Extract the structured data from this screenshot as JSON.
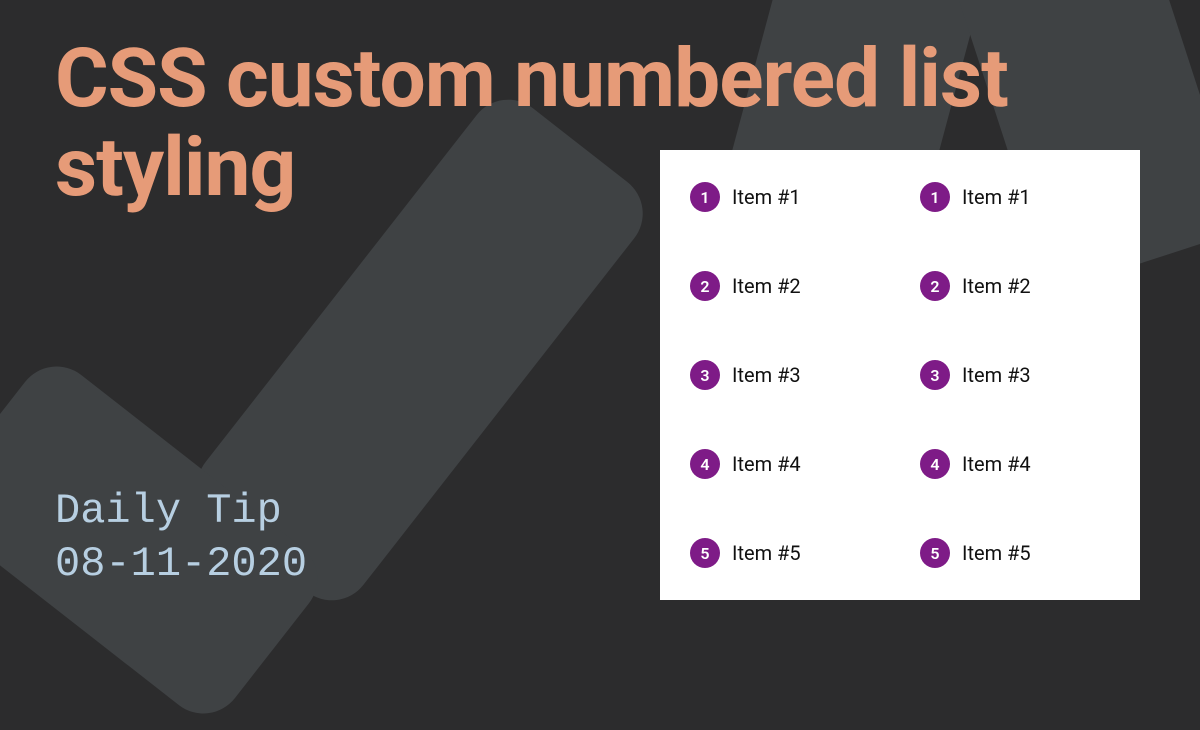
{
  "title": "CSS custom numbered list styling",
  "meta": {
    "label": "Daily Tip",
    "date": "08-11-2020"
  },
  "demo": {
    "col1": [
      {
        "n": "1",
        "text": "Item #1"
      },
      {
        "n": "2",
        "text": "Item #2"
      },
      {
        "n": "3",
        "text": "Item #3"
      },
      {
        "n": "4",
        "text": "Item #4"
      },
      {
        "n": "5",
        "text": "Item #5"
      }
    ],
    "col2": [
      {
        "n": "1",
        "text": "Item #1"
      },
      {
        "n": "2",
        "text": "Item #2"
      },
      {
        "n": "3",
        "text": "Item #3"
      },
      {
        "n": "4",
        "text": "Item #4"
      },
      {
        "n": "5",
        "text": "Item #5"
      }
    ]
  }
}
